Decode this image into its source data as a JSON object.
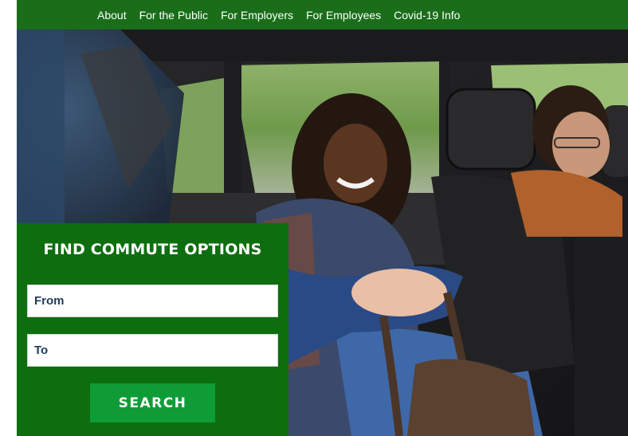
{
  "nav": {
    "items": [
      {
        "label": "About"
      },
      {
        "label": "For the Public"
      },
      {
        "label": "For Employers"
      },
      {
        "label": "For Employees"
      },
      {
        "label": "Covid-19 Info"
      }
    ]
  },
  "hero": {
    "image": "two-passengers-in-car-photo"
  },
  "finder": {
    "title": "FIND COMMUTE OPTIONS",
    "from_placeholder": "From",
    "to_placeholder": "To",
    "search_label": "SEARCH"
  },
  "colors": {
    "nav_bg": "#1a6e1a",
    "panel_bg": "#0d6e0d",
    "button_bg": "#0f9c37",
    "field_text": "#1d3c5c"
  }
}
